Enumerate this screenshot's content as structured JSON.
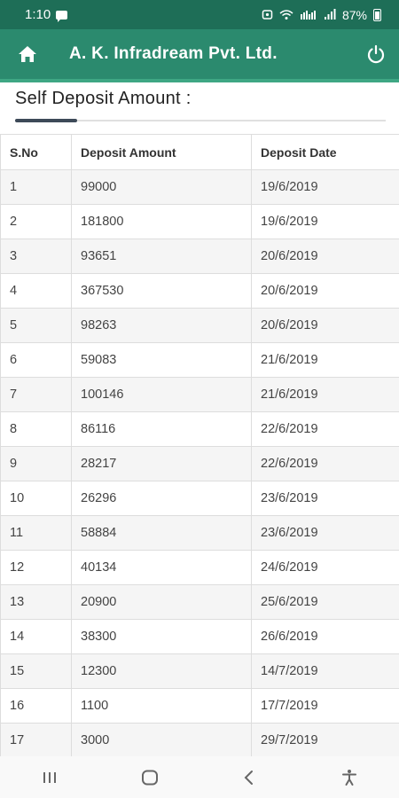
{
  "status_bar": {
    "time": "1:10",
    "battery": "87%",
    "icons": [
      "message-icon",
      "alarm-icon",
      "wifi-icon",
      "volte-icon",
      "signal-icon",
      "battery-icon"
    ]
  },
  "app_bar": {
    "title": "A. K. Infradream Pvt. Ltd.",
    "color": "#2b8a6e",
    "left_icon": "home-icon",
    "right_icon": "power-icon"
  },
  "section": {
    "title": "Self Deposit Amount :"
  },
  "table": {
    "headers": [
      "S.No",
      "Deposit Amount",
      "Deposit Date"
    ],
    "rows": [
      [
        "1",
        "99000",
        "19/6/2019"
      ],
      [
        "2",
        "181800",
        "19/6/2019"
      ],
      [
        "3",
        "93651",
        "20/6/2019"
      ],
      [
        "4",
        "367530",
        "20/6/2019"
      ],
      [
        "5",
        "98263",
        "20/6/2019"
      ],
      [
        "6",
        "59083",
        "21/6/2019"
      ],
      [
        "7",
        "100146",
        "21/6/2019"
      ],
      [
        "8",
        "86116",
        "22/6/2019"
      ],
      [
        "9",
        "28217",
        "22/6/2019"
      ],
      [
        "10",
        "26296",
        "23/6/2019"
      ],
      [
        "11",
        "58884",
        "23/6/2019"
      ],
      [
        "12",
        "40134",
        "24/6/2019"
      ],
      [
        "13",
        "20900",
        "25/6/2019"
      ],
      [
        "14",
        "38300",
        "26/6/2019"
      ],
      [
        "15",
        "12300",
        "14/7/2019"
      ],
      [
        "16",
        "1100",
        "17/7/2019"
      ],
      [
        "17",
        "3000",
        "29/7/2019"
      ]
    ]
  },
  "nav_bar": {
    "icons": [
      "recent-apps-icon",
      "home-circle-icon",
      "back-icon",
      "accessibility-icon"
    ]
  }
}
